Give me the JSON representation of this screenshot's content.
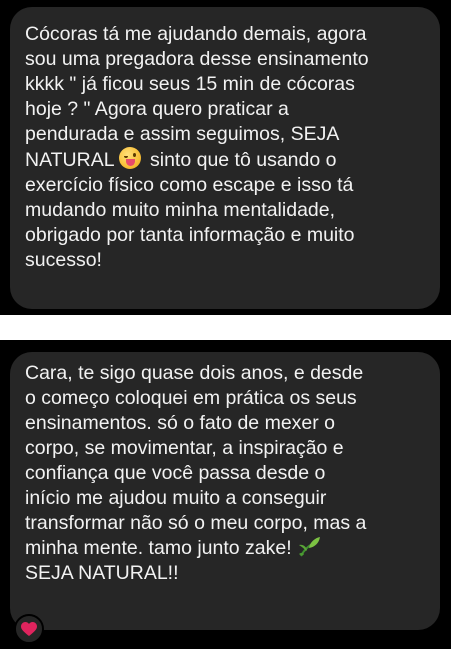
{
  "messages": [
    {
      "lines": [
        "Cócoras tá me ajudando demais, agora",
        "sou uma pregadora desse ensinamento",
        "kkkk \" já ficou seus 15 min de cócoras",
        "hoje ? \" Agora quero praticar a",
        "pendurada e assim seguimos, SEJA",
        "NATURAL",
        "sinto que tô usando o",
        "exercício físico como escape e isso tá",
        "mudando muito minha mentalidade,",
        "obrigado por tanta informação e muito",
        "sucesso!"
      ],
      "inline_emoji": "zany-wink-face-icon"
    },
    {
      "lines": [
        "Cara, te sigo quase dois anos, e desde",
        "o começo coloquei em prática os seus",
        "ensinamentos. só o fato de mexer o",
        "corpo, se movimentar, a inspiração e",
        "confiança que você passa desde o",
        "início me ajudou muito a conseguir",
        "transformar não só o meu corpo, mas a",
        "minha mente. tamo junto zake!",
        "SEJA NATURAL!!"
      ],
      "inline_emoji": "herb-leaf-icon",
      "reaction": "heart-icon"
    }
  ],
  "colors": {
    "background": "#000000",
    "bubble": "#262626",
    "text": "#f2f2f2",
    "divider": "#ffffff",
    "heart": "#e0245e"
  }
}
